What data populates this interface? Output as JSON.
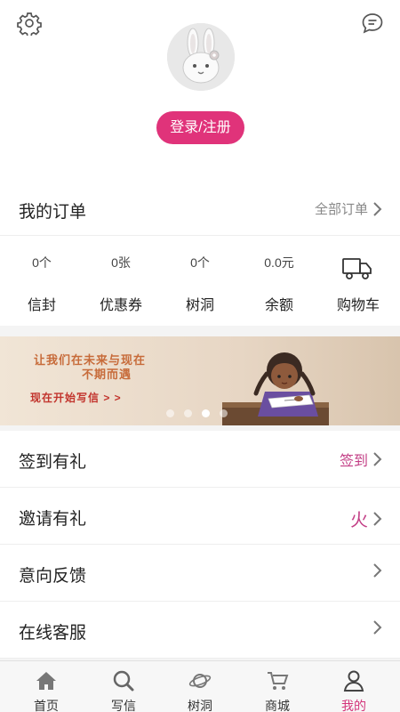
{
  "header": {
    "settings_icon": "gear-icon",
    "message_icon": "chat-bubble-icon",
    "avatar_icon": "bunny-avatar",
    "login_label": "登录/注册",
    "accent_color": "#e0337a"
  },
  "orders": {
    "title": "我的订单",
    "all_label": "全部订单"
  },
  "stats": [
    {
      "value": "0个",
      "label": "信封"
    },
    {
      "value": "0张",
      "label": "优惠券"
    },
    {
      "value": "0个",
      "label": "树洞"
    },
    {
      "value": "0.0元",
      "label": "余额"
    },
    {
      "icon": "truck-icon",
      "label": "购物车"
    }
  ],
  "banner": {
    "line1": "让我们在未来与现在",
    "line2": "不期而遇",
    "line3": "现在开始写信 > >",
    "slide_count": 4,
    "active_slide": 3
  },
  "menu": [
    {
      "label": "签到有礼",
      "right": "签到"
    },
    {
      "label": "邀请有礼",
      "right": "火"
    },
    {
      "label": "意向反馈",
      "right": ""
    },
    {
      "label": "在线客服",
      "right": ""
    }
  ],
  "tabbar": [
    {
      "label": "首页",
      "icon": "home-icon"
    },
    {
      "label": "写信",
      "icon": "magnifier-icon"
    },
    {
      "label": "树洞",
      "icon": "planet-icon"
    },
    {
      "label": "商城",
      "icon": "cart-icon"
    },
    {
      "label": "我的",
      "icon": "person-icon",
      "active": true
    }
  ],
  "colors": {
    "accent_pink": "#e0337a",
    "menu_pink": "#c33f86",
    "tab_active": "#d4357b"
  }
}
